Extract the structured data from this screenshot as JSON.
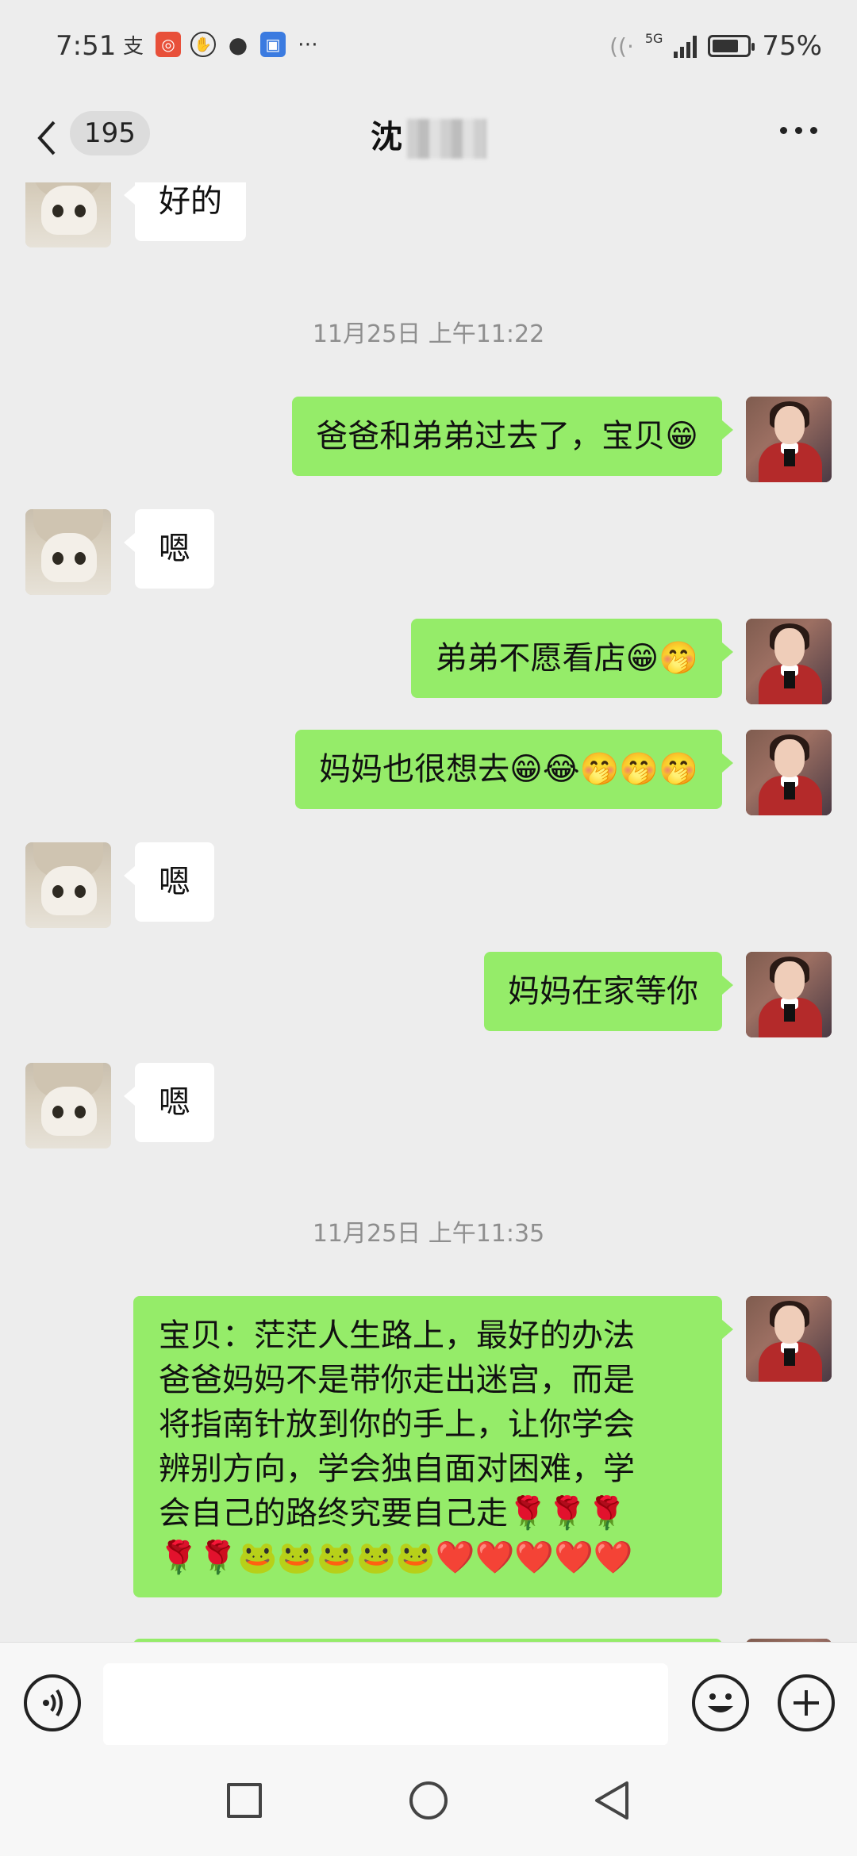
{
  "status_bar": {
    "time": "7:51",
    "network": "5G",
    "battery_percent": "75%",
    "battery_level": 0.75
  },
  "header": {
    "unread_count": "195",
    "title": "沈"
  },
  "messages": [
    {
      "side": "left",
      "text": "好的"
    },
    {
      "type": "timestamp",
      "text": "11月25日 上午11:22"
    },
    {
      "side": "right",
      "text": "爸爸和弟弟过去了，宝贝😁"
    },
    {
      "side": "left",
      "text": "嗯"
    },
    {
      "side": "right",
      "text": "弟弟不愿看店😁🤭"
    },
    {
      "side": "right",
      "text": "妈妈也很想去😁😂🤭🤭🤭"
    },
    {
      "side": "left",
      "text": "嗯"
    },
    {
      "side": "right",
      "text": "妈妈在家等你"
    },
    {
      "side": "left",
      "text": "嗯"
    },
    {
      "type": "timestamp",
      "text": "11月25日 上午11:35"
    },
    {
      "side": "right",
      "lines": [
        "宝贝：茫茫人生路上，最好的办法",
        "爸爸妈妈不是带你走出迷宫，而是",
        "将指南针放到你的手上，让你学会",
        "辨别方向，学会独自面对困难，学",
        "会自己的路终究要自己走🌹🌹🌹",
        "🌹🌹🐸🐸🐸🐸🐸❤️❤️❤️❤️❤️"
      ]
    }
  ],
  "input": {
    "placeholder": ""
  }
}
